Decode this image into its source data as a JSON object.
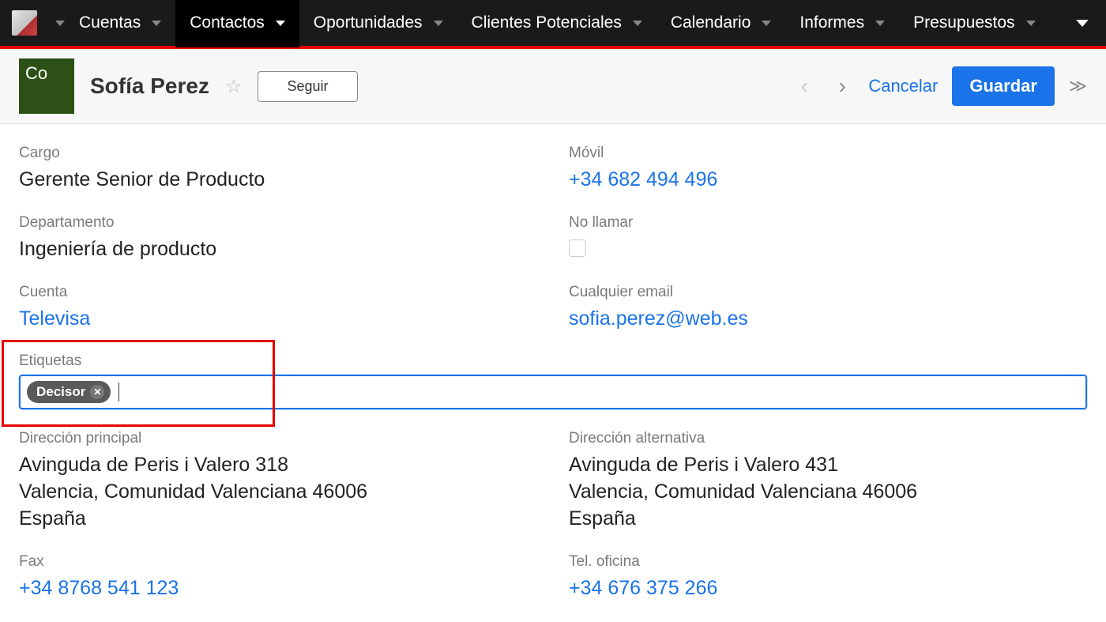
{
  "nav": {
    "items": [
      {
        "label": "Cuentas",
        "active": false
      },
      {
        "label": "Contactos",
        "active": true
      },
      {
        "label": "Oportunidades",
        "active": false
      },
      {
        "label": "Clientes Potenciales",
        "active": false
      },
      {
        "label": "Calendario",
        "active": false
      },
      {
        "label": "Informes",
        "active": false
      },
      {
        "label": "Presupuestos",
        "active": false
      }
    ]
  },
  "header": {
    "avatar_initials": "Co",
    "record_name": "Sofía Perez",
    "follow_label": "Seguir",
    "cancel_label": "Cancelar",
    "save_label": "Guardar"
  },
  "fields": {
    "cargo": {
      "label": "Cargo",
      "value": "Gerente Senior de Producto"
    },
    "movil": {
      "label": "Móvil",
      "value": "+34 682 494 496"
    },
    "departamento": {
      "label": "Departamento",
      "value": "Ingeniería de producto"
    },
    "no_llamar": {
      "label": "No llamar",
      "checked": false
    },
    "cuenta": {
      "label": "Cuenta",
      "value": "Televisa"
    },
    "cualquier_email": {
      "label": "Cualquier email",
      "value": "sofia.perez@web.es"
    },
    "etiquetas": {
      "label": "Etiquetas",
      "tags": [
        "Decisor"
      ]
    },
    "dir_principal": {
      "label": "Dirección principal",
      "line1": "Avinguda de Peris i Valero 318",
      "line2": "Valencia,  Comunidad Valenciana  46006",
      "line3": "España"
    },
    "dir_alt": {
      "label": "Dirección alternativa",
      "line1": "Avinguda de Peris i Valero 431",
      "line2": "Valencia,  Comunidad Valenciana  46006",
      "line3": "España"
    },
    "fax": {
      "label": "Fax",
      "value": "+34 8768 541 123"
    },
    "tel_oficina": {
      "label": "Tel. oficina",
      "value": "+34 676 375 266"
    }
  }
}
